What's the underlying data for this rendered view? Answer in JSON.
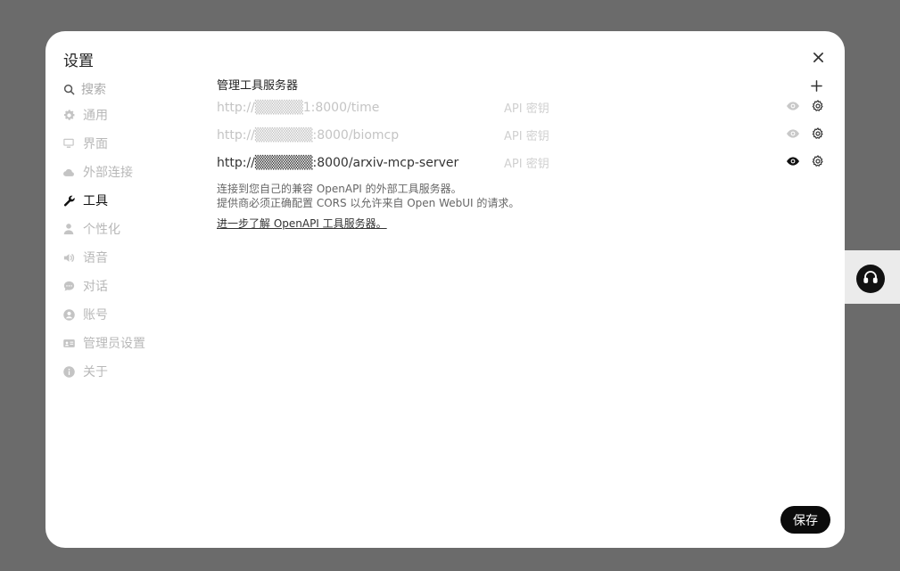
{
  "modal": {
    "title": "设置",
    "close_icon": "close-icon"
  },
  "sidebar": {
    "search_placeholder": "搜索",
    "items": [
      {
        "label": "通用",
        "icon": "gear-icon",
        "active": false
      },
      {
        "label": "界面",
        "icon": "monitor-icon",
        "active": false
      },
      {
        "label": "外部连接",
        "icon": "cloud-icon",
        "active": false
      },
      {
        "label": "工具",
        "icon": "wrench-icon",
        "active": true
      },
      {
        "label": "个性化",
        "icon": "user-icon",
        "active": false
      },
      {
        "label": "语音",
        "icon": "speaker-icon",
        "active": false
      },
      {
        "label": "对话",
        "icon": "chat-bubble-icon",
        "active": false
      },
      {
        "label": "账号",
        "icon": "user-circle-icon",
        "active": false
      },
      {
        "label": "管理员设置",
        "icon": "id-card-icon",
        "active": false
      },
      {
        "label": "关于",
        "icon": "info-icon",
        "active": false
      }
    ]
  },
  "tools": {
    "section_title": "管理工具服务器",
    "servers": [
      {
        "url": "http://▒▒▒▒▒1:8000/time",
        "key_label": "API 密钥",
        "enabled": false
      },
      {
        "url": "http://▒▒▒▒▒▒:8000/biomcp",
        "key_label": "API 密钥",
        "enabled": false
      },
      {
        "url": "http://▒▒▒▒▒▒:8000/arxiv-mcp-server",
        "key_label": "API 密钥",
        "enabled": true
      }
    ],
    "help_line1": "连接到您自己的兼容 OpenAPI 的外部工具服务器。",
    "help_line2": "提供商必须正确配置 CORS 以允许来自 Open WebUI 的请求。",
    "help_link": "进一步了解 OpenAPI 工具服务器。"
  },
  "footer": {
    "save_label": "保存"
  },
  "floating": {
    "icon": "headphones-icon"
  },
  "colors": {
    "backdrop": "#6b6b6b",
    "panel": "#ffffff",
    "accent": "#0b0b0b",
    "muted": "#b8b8b8"
  }
}
